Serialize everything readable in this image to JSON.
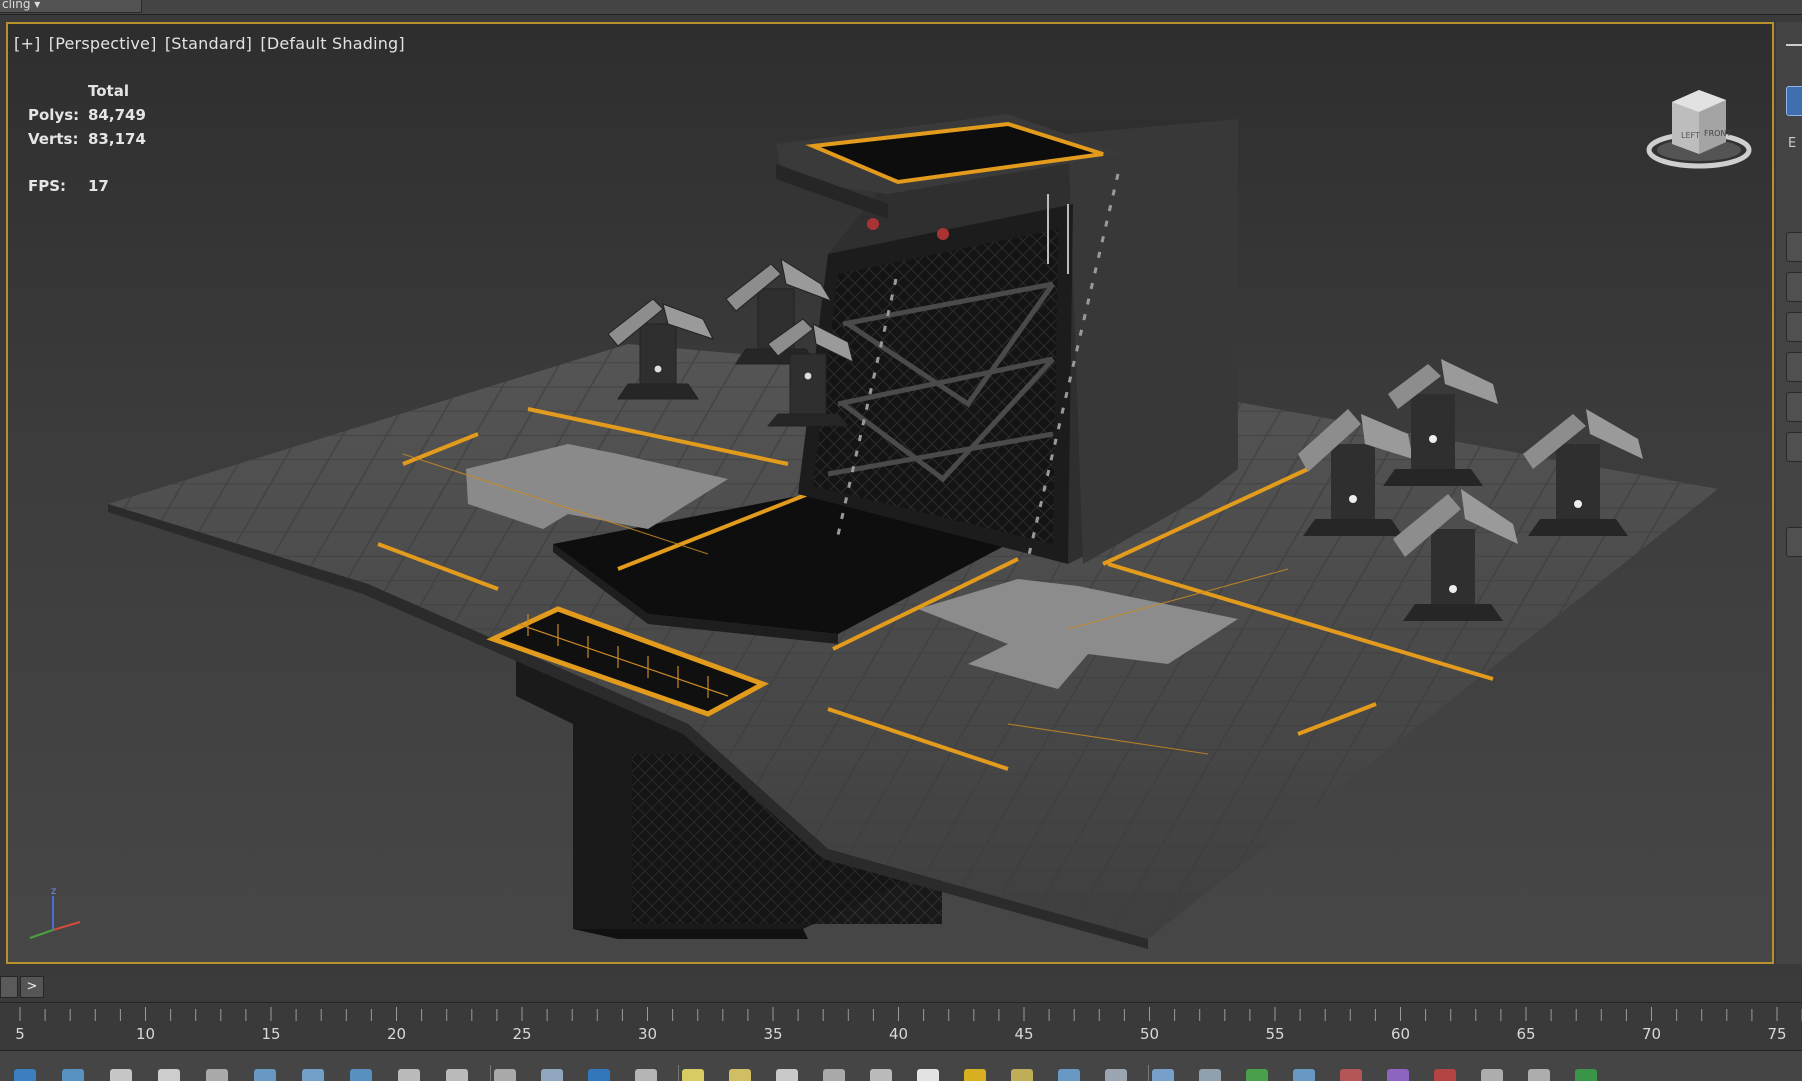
{
  "window": {
    "top_tab_label": "cling ▾"
  },
  "viewport": {
    "label_plus": "[+]",
    "label_view": "[Perspective]",
    "label_standard": "[Standard]",
    "label_shading": "[Default Shading]",
    "stats": {
      "header": "Total",
      "polys_label": "Polys:",
      "polys_value": "84,749",
      "verts_label": "Verts:",
      "verts_value": "83,174",
      "fps_label": "FPS:",
      "fps_value": "17"
    },
    "viewcube": {
      "icon": "viewcube-icon",
      "face_left": "LEFT",
      "face_front": "FRONT"
    },
    "axis_tripod": {
      "icon": "axis-tripod-icon",
      "z_label": "z"
    }
  },
  "right_panel": {
    "letter": "E"
  },
  "timeline": {
    "next_label": ">"
  },
  "ruler": {
    "labels": [
      "5",
      "10",
      "15",
      "20",
      "25",
      "30",
      "35",
      "40",
      "45",
      "50",
      "55",
      "60",
      "65",
      "70",
      "75"
    ]
  },
  "toolbar": {
    "icons": [
      "terrain-icon",
      "box-icon",
      "image-icon",
      "text-icon",
      "rotate-icon",
      "monitor-icon",
      "sphere-icon",
      "layout-icon",
      "layout2-icon",
      "grid-icon",
      "move-icon",
      "camera-icon",
      "render-icon",
      "calendar-icon",
      "light-icon",
      "cloud-icon",
      "target-icon",
      "gear-icon",
      "person-icon",
      "lightbulb-icon",
      "sun-icon",
      "orb-icon",
      "dots-icon",
      "wrench-icon",
      "arrow-up-icon",
      "settings-icon",
      "plant-icon",
      "globe-icon",
      "material-icon",
      "vr-icon",
      "selection-icon",
      "trash-icon",
      "clock-icon",
      "export-icon"
    ]
  },
  "colors": {
    "viewport_border": "#b8902c",
    "accent_blue": "#3f6fae",
    "hazard_orange": "#e29b1d",
    "toolbar_green": "#3aa34a"
  }
}
